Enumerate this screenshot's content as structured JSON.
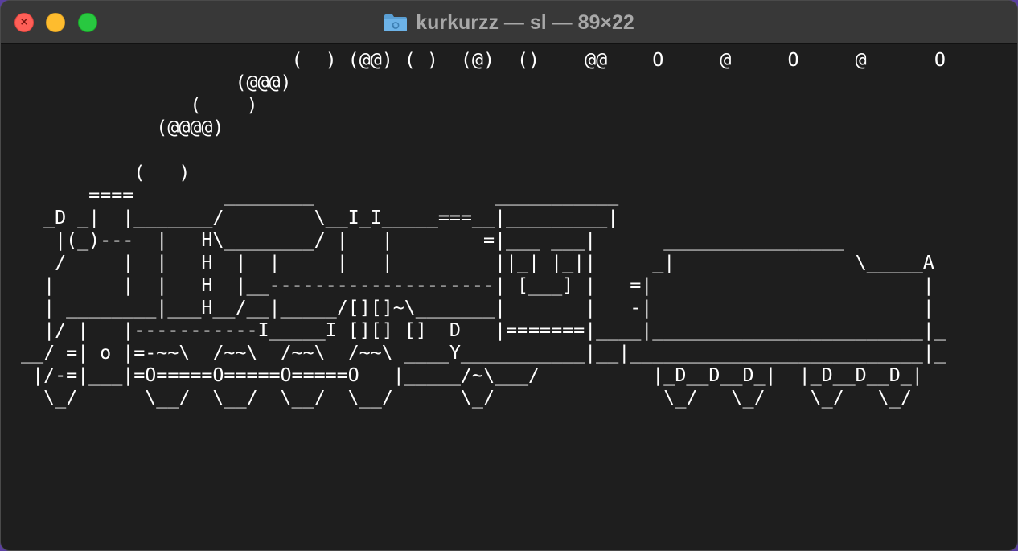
{
  "window": {
    "title": "kurkurzz — sl — 89×22",
    "folder_icon": "folder-icon",
    "close_icon_glyph": "×"
  },
  "colors": {
    "background": "#1e1e1e",
    "titlebar": "#383838",
    "title_text": "#a8a8a8",
    "terminal_text": "#ffffff",
    "close": "#fe5f57",
    "minimize": "#febc2e",
    "zoom": "#28c840"
  },
  "terminal": {
    "lines": [
      "                         (  ) (@@) ( )  (@)  ()    @@    O     @     O     @      O",
      "                    (@@@)",
      "                (    )",
      "             (@@@@)",
      "",
      "           (   )",
      "       ====        ________                ___________",
      "   _D _|  |_______/        \\__I_I_____===__|_________|",
      "    |(_)---  |   H\\________/ |   |        =|___ ___|      ________________",
      "    /     |  |   H  |  |     |   |         ||_| |_||     _|                \\_____A",
      "   |      |  |   H  |__--------------------| [___] |   =|                        |",
      "   | ________|___H__/__|_____/[][]~\\_______|       |   -|                        |",
      "   |/ |   |-----------I_____I [][] []  D   |=======|____|________________________|_",
      " __/ =| o |=-~~\\  /~~\\  /~~\\  /~~\\ ____Y___________|__|__________________________|_",
      "  |/-=|___|=O=====O=====O=====O   |_____/~\\___/          |_D__D__D_|  |_D__D__D_|",
      "   \\_/      \\__/  \\__/  \\__/  \\__/      \\_/               \\_/   \\_/    \\_/   \\_/"
    ]
  }
}
